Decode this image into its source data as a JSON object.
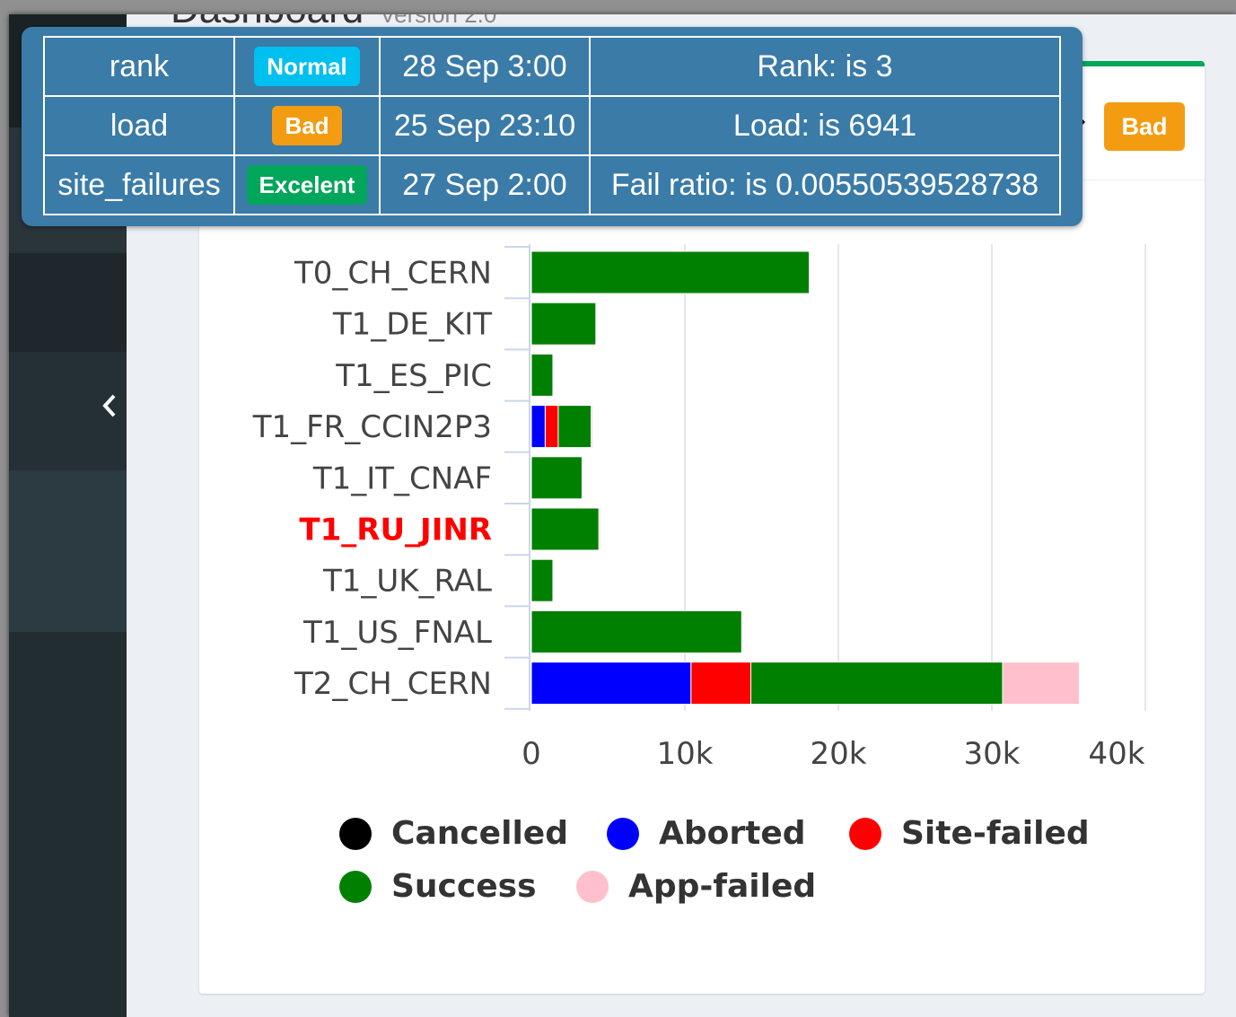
{
  "page": {
    "title": "Dashboard",
    "subtitle": "Version 2.0"
  },
  "header": {
    "status_badge": "Bad",
    "status_color": "#f39c12"
  },
  "tooltip": {
    "rows": [
      {
        "metric": "rank",
        "status": "Normal",
        "status_color": "#00c0ef",
        "time": "28 Sep 3:00",
        "detail": "Rank: is 3"
      },
      {
        "metric": "load",
        "status": "Bad",
        "status_color": "#f39c12",
        "time": "25 Sep 23:10",
        "detail": "Load: is 6941"
      },
      {
        "metric": "site_failures",
        "status": "Excelent",
        "status_color": "#00a65a",
        "time": "27 Sep 2:00",
        "detail": "Fail ratio: is 0.00550539528738"
      }
    ]
  },
  "sidebar": {
    "collapse_icon": "chevron-left-icon"
  },
  "chart_data": {
    "type": "bar",
    "orientation": "horizontal",
    "stacked": true,
    "categories": [
      "T0_CH_CERN",
      "T1_DE_KIT",
      "T1_ES_PIC",
      "T1_FR_CCIN2P3",
      "T1_IT_CNAF",
      "T1_RU_JINR",
      "T1_UK_RAL",
      "T1_US_FNAL",
      "T2_CH_CERN"
    ],
    "highlighted_category": "T1_RU_JINR",
    "highlight_color": "#ff0000",
    "series": [
      {
        "name": "Cancelled",
        "color": "#000000",
        "values": [
          0,
          0,
          0,
          0,
          0,
          0,
          0,
          0,
          0
        ]
      },
      {
        "name": "Aborted",
        "color": "#0000ff",
        "values": [
          0,
          0,
          0,
          900,
          0,
          0,
          0,
          0,
          10400
        ]
      },
      {
        "name": "Site-failed",
        "color": "#ff0000",
        "values": [
          0,
          0,
          0,
          850,
          0,
          0,
          0,
          0,
          3900
        ]
      },
      {
        "name": "Success",
        "color": "#008000",
        "values": [
          18100,
          4200,
          1400,
          2150,
          3300,
          4400,
          1400,
          13700,
          16400
        ]
      },
      {
        "name": "App-failed",
        "color": "#ffc0cb",
        "values": [
          0,
          0,
          0,
          100,
          0,
          100,
          0,
          0,
          5000
        ]
      }
    ],
    "xticks": [
      "0",
      "10k",
      "20k",
      "30k",
      "40k"
    ],
    "xlim": [
      0,
      40000
    ],
    "grid": true,
    "legend_position": "bottom"
  }
}
